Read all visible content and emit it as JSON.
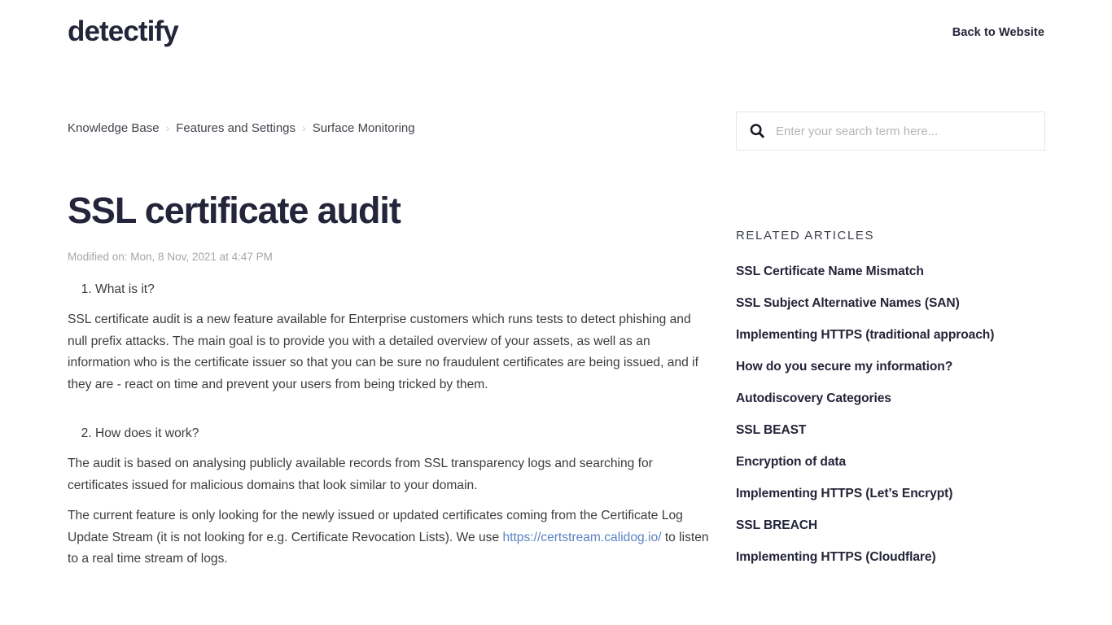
{
  "header": {
    "logo_text": "detectify",
    "back_link_label": "Back to Website"
  },
  "breadcrumb": {
    "items": [
      {
        "label": "Knowledge Base"
      },
      {
        "label": "Features and Settings"
      },
      {
        "label": "Surface Monitoring"
      }
    ],
    "separator": "›"
  },
  "search": {
    "placeholder": "Enter your search term here...",
    "value": "",
    "icon": "search-icon"
  },
  "article": {
    "title": "SSL certificate audit",
    "modified": "Modified on: Mon, 8 Nov, 2021 at 4:47 PM",
    "section1_heading": "What is it?",
    "section1_paragraph": "SSL certificate audit is a new feature available for Enterprise customers which runs tests to detect phishing and null prefix attacks. The main goal is to provide you with a detailed overview of your assets, as well as an information who is the certificate issuer so that you can be sure no fraudulent certificates are being issued, and if they are - react on time and prevent your users from being tricked by them.",
    "section2_heading": "How does it work?",
    "section2_paragraph": "The audit is based on analysing publicly available records from SSL transparency logs and searching for certificates issued for malicious domains that look similar to your domain.",
    "section2_paragraph_b_before": "The current feature is only looking for the newly issued or updated certificates coming from the Certificate Log Update Stream (it is not looking for e.g. Certificate Revocation Lists). We use ",
    "section2_link_text": "https://certstream.calidog.io/",
    "section2_paragraph_b_after": " to listen to a real time stream of logs."
  },
  "related": {
    "heading": "RELATED ARTICLES",
    "items": [
      {
        "label": "SSL Certificate Name Mismatch"
      },
      {
        "label": "SSL Subject Alternative Names (SAN)"
      },
      {
        "label": "Implementing HTTPS (traditional approach)"
      },
      {
        "label": "How do you secure my information?"
      },
      {
        "label": "Autodiscovery Categories"
      },
      {
        "label": "SSL BEAST"
      },
      {
        "label": "Encryption of data"
      },
      {
        "label": "Implementing HTTPS (Let’s Encrypt)"
      },
      {
        "label": "SSL BREACH"
      },
      {
        "label": "Implementing HTTPS (Cloudflare)"
      }
    ]
  },
  "colors": {
    "text_dark": "#24243a",
    "text_body": "#3c3c3c",
    "muted": "#a6a6ac",
    "link_blue": "#5b82c4",
    "border": "#e6e6e6",
    "background": "#ffffff"
  }
}
